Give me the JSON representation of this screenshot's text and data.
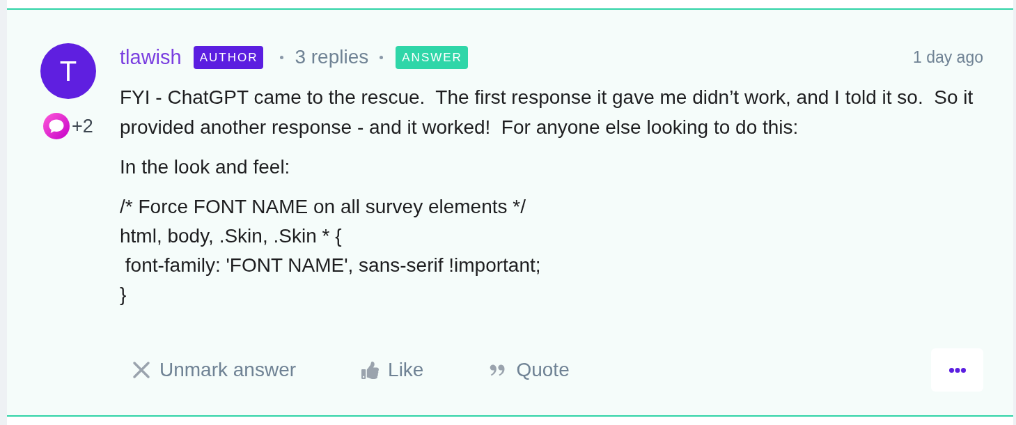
{
  "post": {
    "avatar": {
      "initial": "T"
    },
    "badge_count": "+2",
    "author": "tlawish",
    "author_tag": "AUTHOR",
    "replies": "3 replies",
    "answer_tag": "ANSWER",
    "timestamp": "1 day ago"
  },
  "body": {
    "paragraphs": [
      "FYI - ChatGPT came to the rescue.  The first response it gave me didn’t work, and I told it so.  So it provided another response - and it worked!  For anyone else looking to do this:",
      "In the look and feel:"
    ],
    "code_lines": [
      "/* Force FONT NAME on all survey elements */",
      "html, body, .Skin, .Skin * {",
      " font-family: 'FONT NAME', sans-serif !important;",
      "}"
    ]
  },
  "actions": [
    {
      "kind": "unmark",
      "label": "Unmark answer"
    },
    {
      "kind": "like",
      "label": "Like"
    },
    {
      "kind": "quote",
      "label": "Quote"
    }
  ]
}
